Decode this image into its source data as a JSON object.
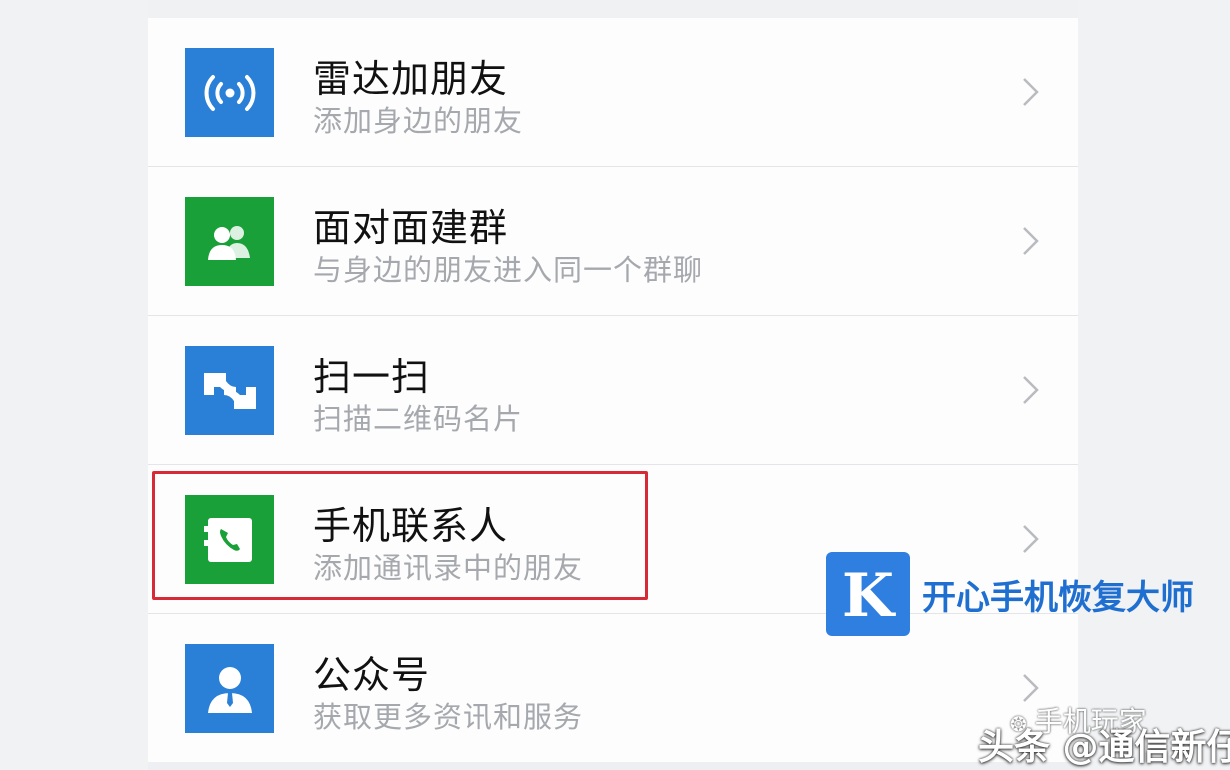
{
  "items": [
    {
      "title": "雷达加朋友",
      "subtitle": "添加身边的朋友",
      "icon": "radar-icon",
      "color": "#2a7fd6"
    },
    {
      "title": "面对面建群",
      "subtitle": "与身边的朋友进入同一个群聊",
      "icon": "group-icon",
      "color": "#1aa038"
    },
    {
      "title": "扫一扫",
      "subtitle": "扫描二维码名片",
      "icon": "scan-icon",
      "color": "#2a7fd6"
    },
    {
      "title": "手机联系人",
      "subtitle": "添加通讯录中的朋友",
      "icon": "phone-contacts-icon",
      "color": "#1aa038",
      "highlighted": true
    },
    {
      "title": "公众号",
      "subtitle": "获取更多资讯和服务",
      "icon": "official-account-icon",
      "color": "#2a7fd6"
    }
  ],
  "logo": {
    "letter": "K",
    "name": "开心手机恢复大师",
    "color": "#2f7fe0"
  },
  "watermark": {
    "account": "手机玩家",
    "source": "头条 @通信新仔"
  },
  "highlight_color": "#d62a37"
}
